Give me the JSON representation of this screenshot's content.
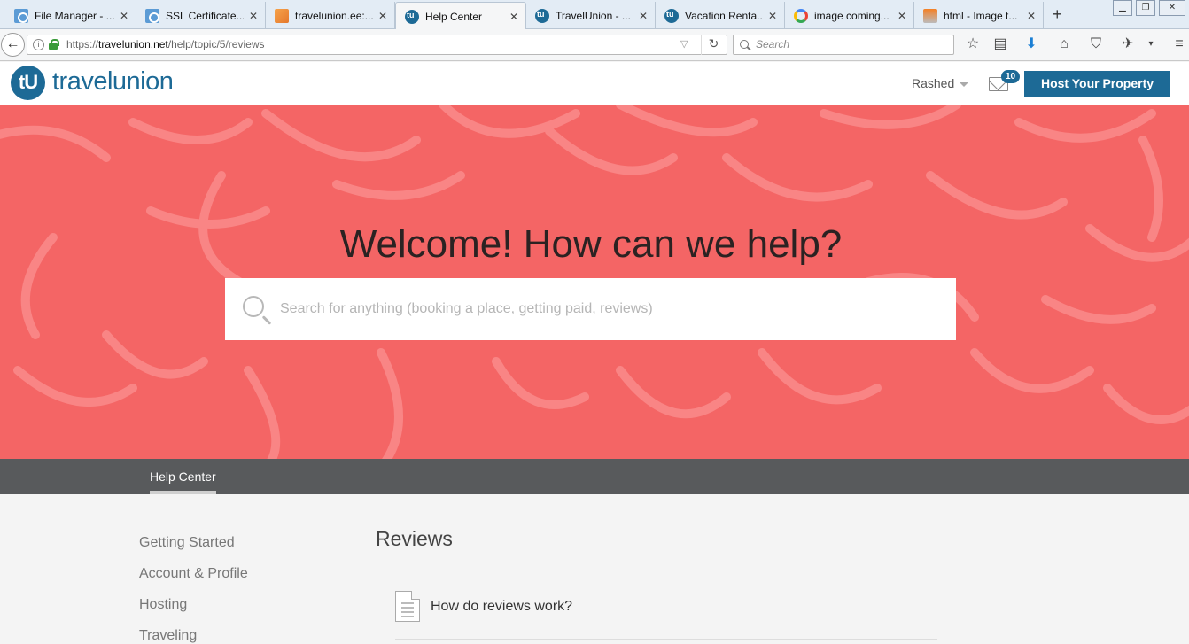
{
  "browser": {
    "tabs": [
      {
        "title": "File Manager - ...",
        "icon": "cpanel-icon",
        "active": false
      },
      {
        "title": "SSL Certificate...",
        "icon": "cpanel-icon",
        "active": false
      },
      {
        "title": "travelunion.ee:...",
        "icon": "phpmyadmin-icon",
        "active": false
      },
      {
        "title": "Help Center",
        "icon": "travelunion-icon",
        "active": true
      },
      {
        "title": "TravelUnion - ...",
        "icon": "travelunion-icon",
        "active": false
      },
      {
        "title": "Vacation Renta...",
        "icon": "travelunion-icon",
        "active": false
      },
      {
        "title": "image coming...",
        "icon": "google-icon",
        "active": false
      },
      {
        "title": "html - Image t...",
        "icon": "stackoverflow-icon",
        "active": false
      }
    ],
    "close_glyph": "✕",
    "new_tab_glyph": "+",
    "url_prefix": "https://",
    "url_host": "travelunion.net",
    "url_path": "/help/topic/5/reviews",
    "search_placeholder": "Search"
  },
  "header": {
    "logo_mark": "tU",
    "logo_text": "travelunion",
    "user_name": "Rashed",
    "mail_count": "10",
    "host_button": "Host Your Property"
  },
  "hero": {
    "title": "Welcome! How can we help?",
    "search_placeholder": "Search for anything (booking a place, getting paid, reviews)",
    "background_color": "#f46565"
  },
  "section_nav": {
    "active_item": "Help Center"
  },
  "sidebar": {
    "items": [
      "Getting Started",
      "Account & Profile",
      "Hosting",
      "Traveling"
    ]
  },
  "main": {
    "title": "Reviews",
    "articles": [
      "How do reviews work?"
    ]
  },
  "colors": {
    "brand": "#1d6a96",
    "hero": "#f46565",
    "nav": "#585a5c"
  }
}
